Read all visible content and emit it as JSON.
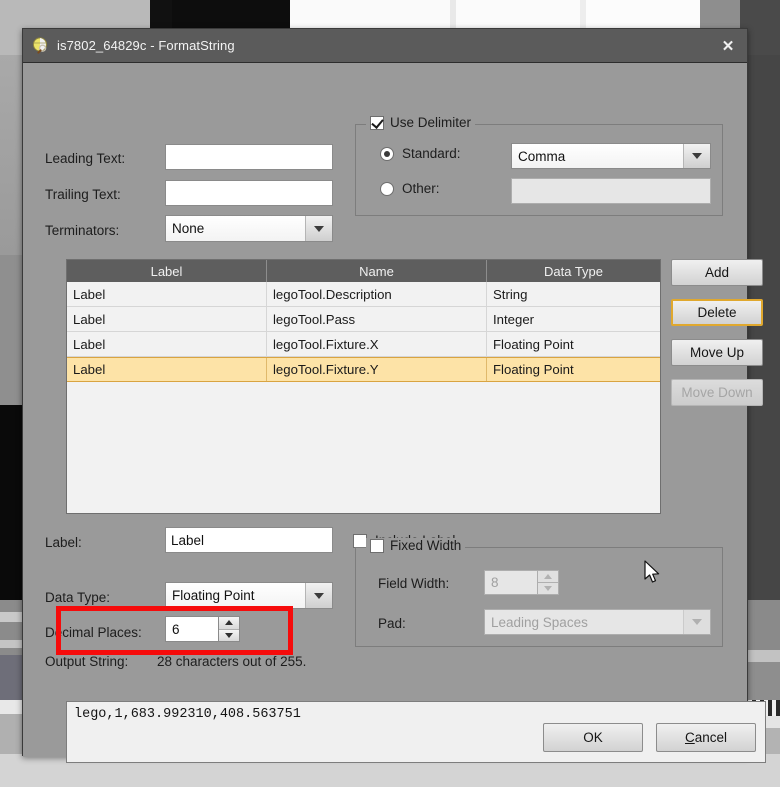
{
  "window": {
    "title": "is7802_64829c - FormatString",
    "icon": "app-sphere-icon",
    "close_label": "✕"
  },
  "form": {
    "leading_text_label": "Leading Text:",
    "leading_text_value": "",
    "trailing_text_label": "Trailing Text:",
    "trailing_text_value": "",
    "terminators_label": "Terminators:",
    "terminators_value": "None"
  },
  "delimiter": {
    "group_label": "Use Delimiter",
    "group_checked": true,
    "standard_label": "Standard:",
    "standard_selected": true,
    "standard_value": "Comma",
    "other_label": "Other:",
    "other_selected": false,
    "other_value": "",
    "other_enabled": false
  },
  "table": {
    "columns": [
      "Label",
      "Name",
      "Data Type"
    ],
    "rows": [
      {
        "label": "Label",
        "name": "legoTool.Description",
        "data_type": "String",
        "selected": false
      },
      {
        "label": "Label",
        "name": "legoTool.Pass",
        "data_type": "Integer",
        "selected": false
      },
      {
        "label": "Label",
        "name": "legoTool.Fixture.X",
        "data_type": "Floating Point",
        "selected": false
      },
      {
        "label": "Label",
        "name": "legoTool.Fixture.Y",
        "data_type": "Floating Point",
        "selected": true
      }
    ]
  },
  "list_buttons": {
    "add": "Add",
    "delete": "Delete",
    "move_up": "Move Up",
    "move_down": "Move Down",
    "delete_focused": true,
    "move_down_disabled": true
  },
  "item_editor": {
    "label_label": "Label:",
    "label_value": "Label",
    "include_label_label": "Include Label",
    "include_label_checked": false,
    "data_type_label": "Data Type:",
    "data_type_value": "Floating Point",
    "decimal_places_label": "Decimal Places:",
    "decimal_places_value": "6"
  },
  "fixed_width": {
    "group_label": "Fixed Width",
    "group_checked": false,
    "field_width_label": "Field Width:",
    "field_width_value": "8",
    "pad_label": "Pad:",
    "pad_value": "Leading Spaces",
    "enabled": false
  },
  "output": {
    "label": "Output String:",
    "count_text": "28 characters out of 255.",
    "value": "lego,1,683.992310,408.563751"
  },
  "dialog_buttons": {
    "ok": "OK",
    "cancel_prefix": "",
    "cancel_mnemonic": "C",
    "cancel_rest": "ancel"
  },
  "annotation": {
    "highlight_color": "#f60b0b",
    "target": "decimal-places-field"
  }
}
